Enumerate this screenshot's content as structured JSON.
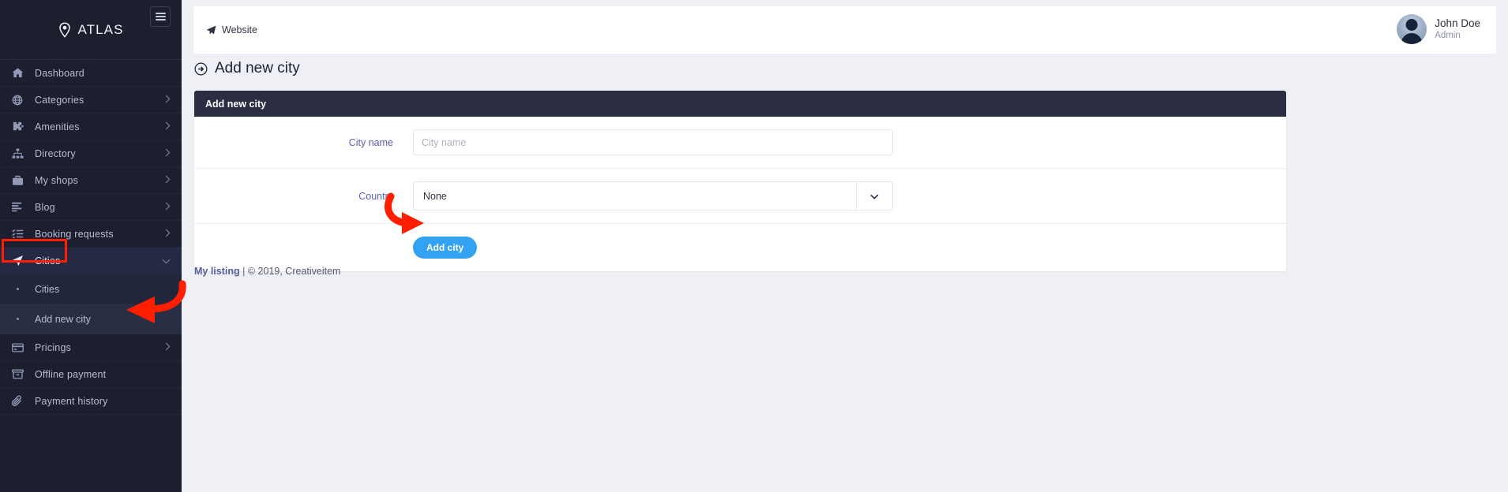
{
  "brand": {
    "name": "ATLAS",
    "logo_icon": "map-pin-icon"
  },
  "sidebar": {
    "toggle_icon": "hamburger-icon",
    "items": [
      {
        "label": "Dashboard",
        "icon": "home-icon",
        "has_chevron": false,
        "active": false
      },
      {
        "label": "Categories",
        "icon": "globe-icon",
        "has_chevron": true,
        "active": false
      },
      {
        "label": "Amenities",
        "icon": "puzzle-icon",
        "has_chevron": true,
        "active": false
      },
      {
        "label": "Directory",
        "icon": "sitemap-icon",
        "has_chevron": true,
        "active": false
      },
      {
        "label": "My shops",
        "icon": "briefcase-icon",
        "has_chevron": true,
        "active": false
      },
      {
        "label": "Blog",
        "icon": "align-left-icon",
        "has_chevron": true,
        "active": false
      },
      {
        "label": "Booking requests",
        "icon": "tasks-list-icon",
        "has_chevron": true,
        "active": false
      },
      {
        "label": "Cities",
        "icon": "location-arrow-icon",
        "has_chevron": true,
        "active": true
      }
    ],
    "cities_submenu": [
      {
        "label": "Cities",
        "selected": false
      },
      {
        "label": "Add new city",
        "selected": true
      }
    ],
    "items_after": [
      {
        "label": "Pricings",
        "icon": "credit-card-icon",
        "has_chevron": true,
        "active": false
      },
      {
        "label": "Offline payment",
        "icon": "archive-icon",
        "has_chevron": false,
        "active": false
      },
      {
        "label": "Payment history",
        "icon": "paperclip-icon",
        "has_chevron": false,
        "active": false
      }
    ]
  },
  "topbar": {
    "website_label": "Website",
    "website_icon": "paper-plane-icon",
    "user": {
      "name": "John Doe",
      "role": "Admin",
      "avatar_icon": "user-avatar"
    }
  },
  "page": {
    "title": "Add new city",
    "title_icon": "arrow-circle-right-icon"
  },
  "card": {
    "header": "Add new city",
    "fields": [
      {
        "label": "City name",
        "type": "text",
        "value": "",
        "placeholder": "City name"
      },
      {
        "label": "Country",
        "type": "select",
        "value": "None",
        "caret_icon": "chevron-down-icon"
      }
    ],
    "submit_label": "Add city"
  },
  "footer": {
    "brand": "My listing",
    "separator": "|",
    "copyright": "© 2019, Creativeitem"
  },
  "annotations": {
    "highlight_color": "#ff1e00",
    "boxes": [
      "cities-menu-item"
    ],
    "arrows": [
      "arrow-to-add-new-city",
      "arrow-to-add-city-button"
    ]
  }
}
